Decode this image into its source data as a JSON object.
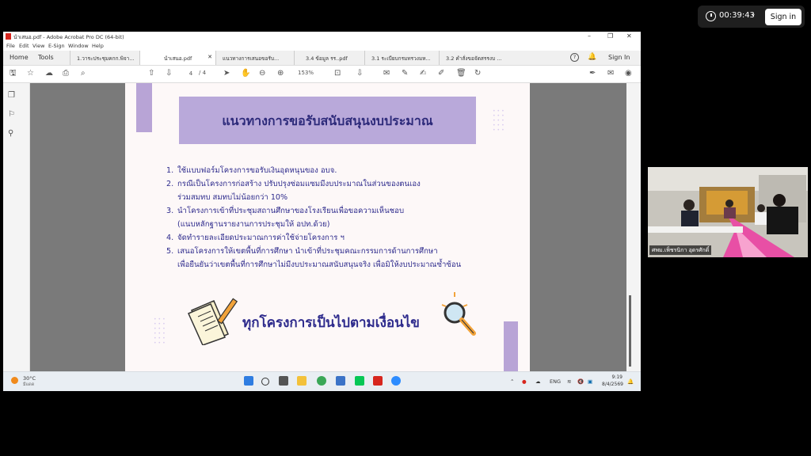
{
  "meeting": {
    "timer": "00:39:43",
    "signin_label": "Sign in",
    "participant_name": "ศพม.เพ็ชรนิกา อุดรศักดิ์"
  },
  "acrobat": {
    "window_title": "นำเสนอ.pdf - Adobe Acrobat Pro DC (64-bit)",
    "menu": [
      "File",
      "Edit",
      "View",
      "E-Sign",
      "Window",
      "Help"
    ],
    "home": "Home",
    "tools": "Tools",
    "tabs": [
      "1.วาระประชุมคกก.พิจา...",
      "นำเสนอ.pdf",
      "แนวทางการเสนอขอรับ...",
      "3.4 ข้อมูล รร..pdf",
      "3.1 ระเบียบกรมทรวงมห...",
      "3.2 คำสั่งขอจัดสรรงบ ..."
    ],
    "active_tab": 1,
    "sign_in": "Sign In",
    "page_current": "4",
    "page_total": "/ 4",
    "zoom": "153%"
  },
  "slide": {
    "title": "แนวทางการขอรับสนับสนุนงบประมาณ",
    "items": [
      {
        "num": "1.",
        "lines": [
          "ใช้แบบฟอร์มโครงการขอรับเงินอุดหนุนของ   อบจ."
        ]
      },
      {
        "num": "2.",
        "lines": [
          "กรณีเป็นโครงการก่อสร้าง   ปรับปรุงซ่อมแซมมีงบประมาณในส่วนของตนเอง",
          "ร่วมสมทบ  สมทบไม่น้อยกว่า  10%"
        ]
      },
      {
        "num": "3.",
        "lines": [
          "นำโครงการเข้าที่ประชุมสถานศึกษาของโรงเรียนเพื่อขอความเห็นชอบ",
          "(แนบหลักฐานรายงานการประชุมให้   อปท.ด้วย)"
        ]
      },
      {
        "num": "4.",
        "lines": [
          "จัดทำรายละเอียดประมาณการค่าใช้จ่ายโครงการ   ฯ"
        ]
      },
      {
        "num": "5.",
        "lines": [
          "เสนอโครงการให้เขตพื้นที่การศึกษา   นำเข้าที่ประชุมคณะกรรมการด้านการศึกษา",
          "เพื่อยืนยันว่าเขตพื้นที่การศึกษาไม่มีงบประมาณสนับสนุนจริง    เพื่อมิให้งบประมาณซ้ำซ้อน"
        ]
      }
    ],
    "footer": "ทุกโครงการเป็นไปตามเงื่อนไข"
  },
  "taskbar": {
    "temperature": "30°C",
    "weather_desc": "มีแดด",
    "lang": "ENG",
    "time": "9:19",
    "date": "8/4/2569"
  },
  "colors": {
    "banner": "#b9a9da",
    "text": "#2d2a8c",
    "accent_bar": "#b8a4d6"
  }
}
